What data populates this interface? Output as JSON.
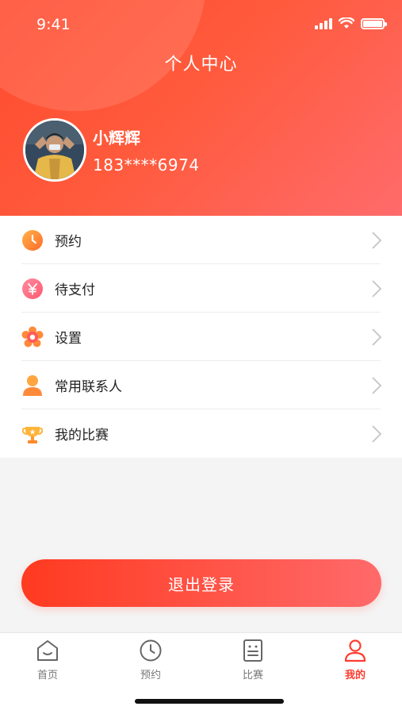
{
  "status_bar": {
    "time": "9:41"
  },
  "header": {
    "title": "个人中心"
  },
  "profile": {
    "name": "小辉辉",
    "phone": "183****6974"
  },
  "menu": {
    "items": [
      {
        "label": "预约",
        "icon": "clock-icon"
      },
      {
        "label": "待支付",
        "icon": "yen-icon"
      },
      {
        "label": "设置",
        "icon": "gear-flower-icon"
      },
      {
        "label": "常用联系人",
        "icon": "contact-person-icon"
      },
      {
        "label": "我的比赛",
        "icon": "trophy-icon"
      }
    ]
  },
  "logout": {
    "label": "退出登录"
  },
  "tabbar": {
    "tabs": [
      {
        "label": "首页",
        "icon": "home-icon"
      },
      {
        "label": "预约",
        "icon": "clock-icon"
      },
      {
        "label": "比赛",
        "icon": "scoreboard-icon"
      },
      {
        "label": "我的",
        "icon": "person-icon",
        "active": true
      }
    ]
  },
  "colors": {
    "accent": "#ff3b2f",
    "gradient_start": "#ff4a2e",
    "gradient_end": "#ff6b6b"
  }
}
